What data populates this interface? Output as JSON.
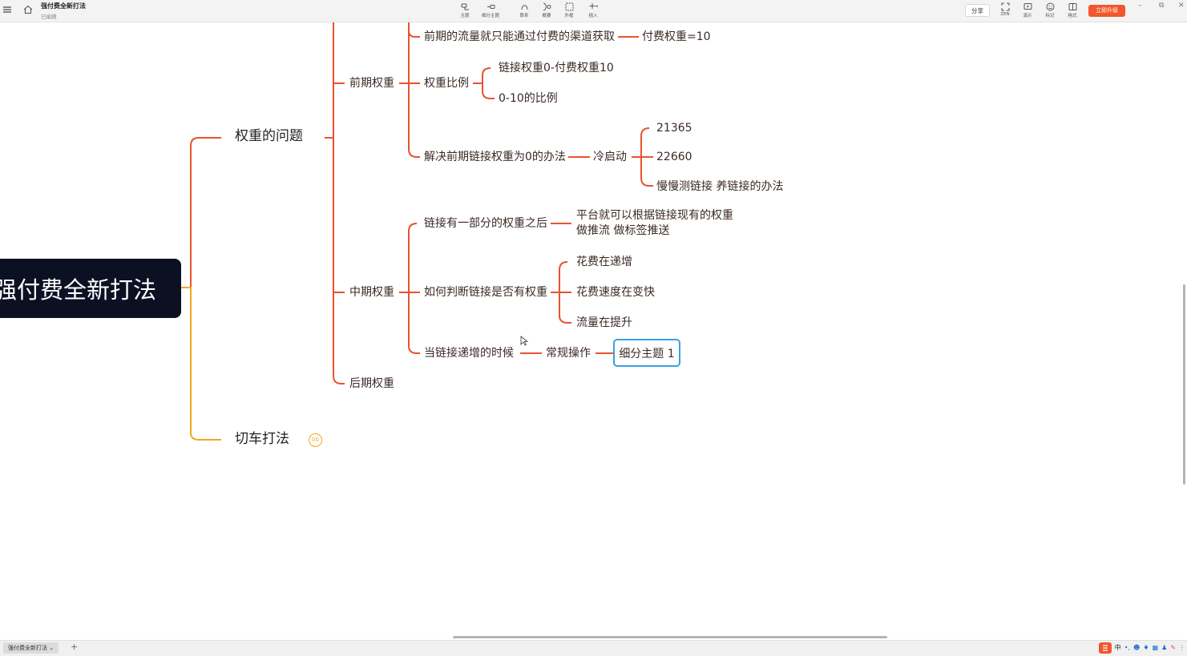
{
  "window": {
    "title": "强付费全新打法",
    "status": "已编辑"
  },
  "toolbar": {
    "tools": [
      {
        "label": "主题",
        "icon": "topic-icon"
      },
      {
        "label": "细分主题",
        "icon": "subtopic-icon"
      },
      {
        "label": "联系",
        "icon": "relationship-icon"
      },
      {
        "label": "概要",
        "icon": "summary-icon"
      },
      {
        "label": "外框",
        "icon": "boundary-icon"
      },
      {
        "label": "插入",
        "icon": "insert-icon"
      }
    ],
    "share_label": "分享",
    "right_tools": [
      {
        "label": "ZEN",
        "icon": "zen-mode-icon"
      },
      {
        "label": "演示",
        "icon": "pitch-icon"
      },
      {
        "label": "标记",
        "icon": "marker-icon"
      },
      {
        "label": "格式",
        "icon": "format-panel-icon"
      }
    ],
    "upgrade_label": "立即升级"
  },
  "mindmap": {
    "root": "强付费全新打法",
    "branches": [
      {
        "label": "权重的问题",
        "children": [
          {
            "label": "前期权重",
            "children": [
              {
                "label": "前期的流量就只能通过付费的渠道获取",
                "children": [
                  {
                    "label": "付费权重=10"
                  }
                ]
              },
              {
                "label": "权重比例",
                "children": [
                  {
                    "label": "链接权重0-付费权重10"
                  },
                  {
                    "label": "0-10的比例"
                  }
                ]
              },
              {
                "label": "解决前期链接权重为0的办法",
                "children": [
                  {
                    "label": "冷启动",
                    "children": [
                      {
                        "label": "21365"
                      },
                      {
                        "label": "22660"
                      },
                      {
                        "label": "慢慢测链接 养链接的办法"
                      }
                    ]
                  }
                ]
              }
            ]
          },
          {
            "label": "中期权重",
            "children": [
              {
                "label": "链接有一部分的权重之后",
                "children": [
                  {
                    "label": "平台就可以根据链接现有的权重",
                    "label_line2": "做推流  做标签推送"
                  }
                ]
              },
              {
                "label": "如何判断链接是否有权重",
                "children": [
                  {
                    "label": "花费在递增"
                  },
                  {
                    "label": "花费速度在变快"
                  },
                  {
                    "label": "流量在提升"
                  }
                ]
              },
              {
                "label": "当链接递增的时候",
                "children": [
                  {
                    "label": "常规操作",
                    "children": [
                      {
                        "label": "细分主题 1"
                      }
                    ]
                  }
                ]
              }
            ]
          },
          {
            "label": "后期权重"
          }
        ]
      },
      {
        "label": "切车打法",
        "collapsed_count": "00"
      }
    ]
  },
  "bottom": {
    "sheet_tab": "强付费全新打法",
    "tray_input": "中"
  },
  "colors": {
    "branch1": "#e8532f",
    "branch2": "#f5a623",
    "selection": "#37a2e0",
    "root_bg": "#0c1023",
    "upgrade": "#f2562b"
  }
}
